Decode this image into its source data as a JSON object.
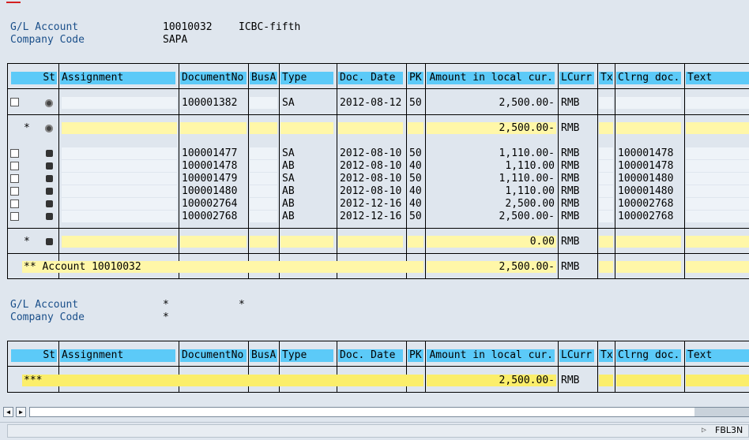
{
  "header1": {
    "gl_label": "G/L Account",
    "gl_value": "10010032",
    "gl_name": "ICBC-fifth",
    "cc_label": "Company Code",
    "cc_value": "SAPA"
  },
  "header2": {
    "gl_label": "G/L Account",
    "gl_value": "*",
    "gl_name": "*",
    "cc_label": "Company Code",
    "cc_value": "*"
  },
  "columns": [
    "St",
    "Assignment",
    "DocumentNo",
    "BusA",
    "Type",
    "Doc. Date",
    "PK",
    "Amount in local cur.",
    "LCurr",
    "Tx",
    "Clrng doc.",
    "Text"
  ],
  "open_items": [
    {
      "doc": "100001382",
      "type": "SA",
      "date": "2012-08-12",
      "pk": "50",
      "amount": "2,500.00-",
      "curr": "RMB",
      "clrng": ""
    }
  ],
  "open_subtotal": {
    "marker": "*",
    "amount": "2,500.00-",
    "curr": "RMB"
  },
  "cleared_items": [
    {
      "doc": "100001477",
      "type": "SA",
      "date": "2012-08-10",
      "pk": "50",
      "amount": "1,110.00-",
      "curr": "RMB",
      "clrng": "100001478"
    },
    {
      "doc": "100001478",
      "type": "AB",
      "date": "2012-08-10",
      "pk": "40",
      "amount": "1,110.00",
      "curr": "RMB",
      "clrng": "100001478"
    },
    {
      "doc": "100001479",
      "type": "SA",
      "date": "2012-08-10",
      "pk": "50",
      "amount": "1,110.00-",
      "curr": "RMB",
      "clrng": "100001480"
    },
    {
      "doc": "100001480",
      "type": "AB",
      "date": "2012-08-10",
      "pk": "40",
      "amount": "1,110.00",
      "curr": "RMB",
      "clrng": "100001480"
    },
    {
      "doc": "100002764",
      "type": "AB",
      "date": "2012-12-16",
      "pk": "40",
      "amount": "2,500.00",
      "curr": "RMB",
      "clrng": "100002768"
    },
    {
      "doc": "100002768",
      "type": "AB",
      "date": "2012-12-16",
      "pk": "50",
      "amount": "2,500.00-",
      "curr": "RMB",
      "clrng": "100002768"
    }
  ],
  "cleared_subtotal": {
    "marker": "*",
    "amount": "0.00",
    "curr": "RMB"
  },
  "account_total": {
    "label": "** Account 10010032",
    "amount": "2,500.00-",
    "curr": "RMB"
  },
  "grand_total": {
    "label": "***",
    "amount": "2,500.00-",
    "curr": "RMB"
  },
  "status": {
    "tcode": "FBL3N"
  },
  "icons": {
    "open_status": "status-open-icon",
    "cleared_status": "status-cleared-icon"
  },
  "colors": {
    "header": "#5ccaf8",
    "subtotal": "#fff7a8",
    "grandtotal": "#fbee6a",
    "label": "#1a4f8a"
  }
}
